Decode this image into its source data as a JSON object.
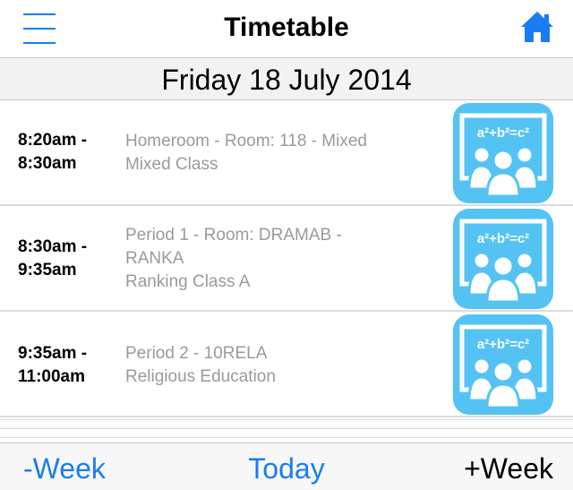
{
  "header": {
    "title": "Timetable",
    "menu_icon": "hamburger-menu-icon",
    "home_icon": "home-icon",
    "accent_color": "#1a7cf3"
  },
  "date": "Friday 18 July 2014",
  "periods": [
    {
      "time": "8:20am -\n8:30am",
      "line1": "Homeroom  -  Room: 118  -  Mixed",
      "line2": "Mixed Class",
      "line3": "",
      "icon": "classroom-icon",
      "icon_text": "a²+b²=c²"
    },
    {
      "time": "8:30am -\n9:35am",
      "line1": "Period 1  -  Room: DRAMAB  -",
      "line2": "RANKA",
      "line3": "Ranking Class A",
      "icon": "classroom-icon",
      "icon_text": "a²+b²=c²"
    },
    {
      "time": "9:35am -\n11:00am",
      "line1": "Period 2  -  10RELA",
      "line2": "Religious Education",
      "line3": "",
      "icon": "classroom-icon",
      "icon_text": "a²+b²=c²"
    }
  ],
  "toolbar": {
    "prev_week": "-Week",
    "today": "Today",
    "next_week": "+Week"
  }
}
